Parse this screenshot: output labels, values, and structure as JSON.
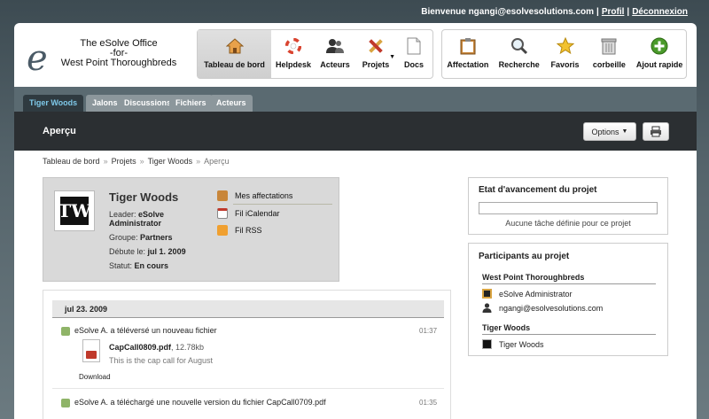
{
  "top": {
    "welcome": "Bienvenue ngangi@esolvesolutions.com",
    "profile": "Profil",
    "logout": "Déconnexion"
  },
  "logo": {
    "mark": "e",
    "line1": "The eSolve Office",
    "line2": "-for-",
    "line3": "West Point Thoroughbreds"
  },
  "toolbar_main": [
    {
      "label": "Tableau de bord",
      "icon": "house-icon"
    },
    {
      "label": "Helpdesk",
      "icon": "lifebuoy-icon"
    },
    {
      "label": "Acteurs",
      "icon": "users-icon"
    },
    {
      "label": "Projets",
      "icon": "tools-icon"
    },
    {
      "label": "Docs",
      "icon": "document-icon"
    }
  ],
  "toolbar_side": [
    {
      "label": "Affectation",
      "icon": "clipboard-icon"
    },
    {
      "label": "Recherche",
      "icon": "magnifier-icon"
    },
    {
      "label": "Favoris",
      "icon": "star-icon"
    },
    {
      "label": "corbeille",
      "icon": "trash-icon"
    },
    {
      "label": "Ajout rapide",
      "icon": "plus-icon"
    }
  ],
  "tabs": [
    "Tiger Woods",
    "Jalons",
    "Discussions",
    "Fichiers",
    "Acteurs"
  ],
  "page": {
    "title": "Aperçu",
    "options": "Options",
    "print_icon": "printer-icon"
  },
  "breadcrumb": [
    "Tableau de bord",
    "Projets",
    "Tiger Woods",
    "Aperçu"
  ],
  "project": {
    "name": "Tiger Woods",
    "avatar_letters": "TW",
    "leader_label": "Leader:",
    "leader": "eSolve Administrator",
    "group_label": "Groupe:",
    "group": "Partners",
    "start_label": "Débute le:",
    "start": "jul 1. 2009",
    "status_label": "Statut:",
    "status": "En cours",
    "links": [
      "Mes affectations",
      "Fil iCalendar",
      "Fil RSS"
    ]
  },
  "stream": {
    "date": "jul 23. 2009",
    "entries": [
      {
        "text": "eSolve A. a téléversé un nouveau fichier",
        "time": "01:37",
        "file_name": "CapCall0809.pdf",
        "file_size": ", 12.78kb",
        "file_desc": "This is the cap call for August",
        "download": "Download"
      },
      {
        "text": "eSolve A. a téléchargé une nouvelle version du fichier CapCall0709.pdf",
        "time": "01:35"
      }
    ]
  },
  "progress": {
    "title": "Etat d'avancement du projet",
    "value": 0,
    "note": "Aucune tâche définie pour ce projet"
  },
  "participants": {
    "title": "Participants au projet",
    "groups": [
      {
        "name": "West Point Thoroughbreds",
        "members": [
          "eSolve Administrator",
          "ngangi@esolvesolutions.com"
        ]
      },
      {
        "name": "Tiger Woods",
        "members": [
          "Tiger Woods"
        ]
      }
    ]
  }
}
